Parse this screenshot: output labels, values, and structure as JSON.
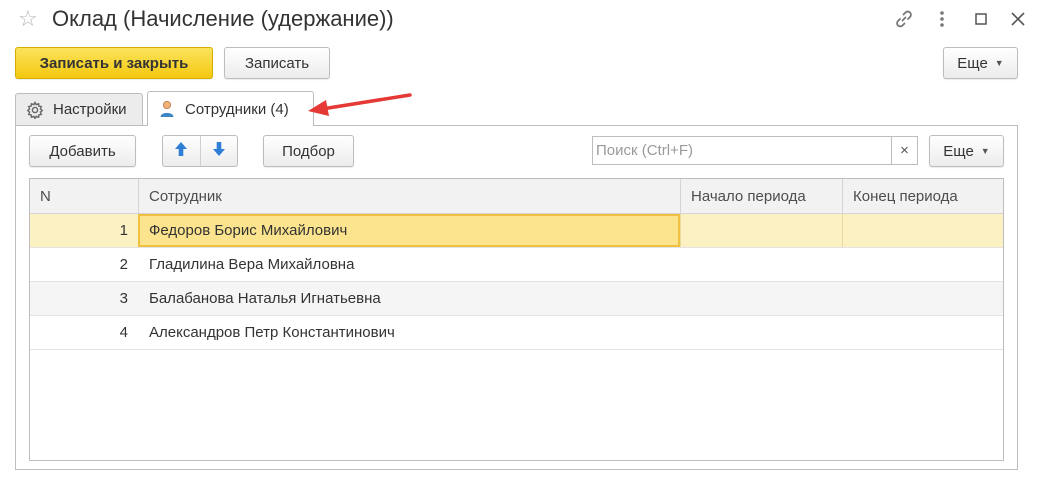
{
  "window": {
    "title": "Оклад (Начисление (удержание))"
  },
  "toolbar": {
    "save_close_label": "Записать и закрыть",
    "save_label": "Записать",
    "more_label": "Еще"
  },
  "tabs": [
    {
      "label": "Настройки",
      "icon": "gear-icon"
    },
    {
      "label": "Сотрудники (4)",
      "icon": "employee-icon"
    }
  ],
  "employees_toolbar": {
    "add_label": "Добавить",
    "pick_label": "Подбор",
    "search_placeholder": "Поиск (Ctrl+F)",
    "clear_symbol": "×",
    "more_label": "Еще"
  },
  "table": {
    "columns": [
      "N",
      "Сотрудник",
      "Начало периода",
      "Конец периода"
    ],
    "rows": [
      {
        "n": "1",
        "employee": "Федоров Борис Михайлович",
        "start": "",
        "end": ""
      },
      {
        "n": "2",
        "employee": "Гладилина Вера Михайловна",
        "start": "",
        "end": ""
      },
      {
        "n": "3",
        "employee": "Балабанова Наталья Игнатьевна",
        "start": "",
        "end": ""
      },
      {
        "n": "4",
        "employee": "Александров Петр Константинович",
        "start": "",
        "end": ""
      }
    ]
  },
  "colors": {
    "primary_button": "#f5cc17",
    "selected_row": "#fcf1c2",
    "annotation_arrow": "#e53935",
    "arrow_icons": "#2f7fd6"
  }
}
